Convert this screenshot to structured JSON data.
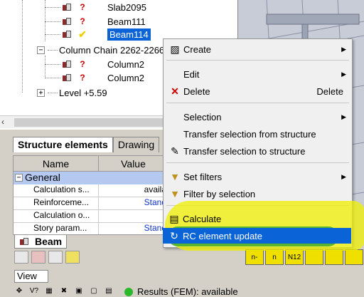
{
  "tree": {
    "rows": [
      {
        "label": "Slab2095",
        "mark": "?",
        "selected": false
      },
      {
        "label": "Beam111",
        "mark": "?",
        "selected": false
      },
      {
        "label": "Beam114",
        "mark": "✔",
        "selected": true
      }
    ],
    "column_chain": "Column Chain 2262-2266",
    "column_rows": [
      {
        "label": "Column2",
        "mark": "?"
      },
      {
        "label": "Column2",
        "mark": "?"
      }
    ],
    "level": "Level +5.59",
    "expand_minus": "−",
    "expand_plus": "+"
  },
  "tabs": {
    "structure": "Structure elements",
    "drawing": "Drawing"
  },
  "grid": {
    "col_name": "Name",
    "col_value": "Value",
    "group": "General",
    "rows": [
      {
        "name": "Calculation s...",
        "value": "availa",
        "blue": false
      },
      {
        "name": "Reinforceme...",
        "value": "Stand",
        "blue": true
      },
      {
        "name": "Calculation o...",
        "value": "",
        "blue": false
      },
      {
        "name": "Story param...",
        "value": "Stand",
        "blue": true
      }
    ]
  },
  "beam_tab": "Beam",
  "view_field": "View",
  "status": {
    "results": "Results (FEM): available",
    "icon2": "V?"
  },
  "context_menu": {
    "create": "Create",
    "edit": "Edit",
    "delete": "Delete",
    "delete_shortcut": "Delete",
    "selection": "Selection",
    "transfer_from": "Transfer selection from structure",
    "transfer_to": "Transfer selection to structure",
    "set_filters": "Set filters",
    "filter_by": "Filter by selection",
    "calculate": "Calculate",
    "rc_update": "RC element update"
  },
  "right_toolbar": {
    "n12": "N12"
  },
  "colors": {
    "selection": "#0a64d8",
    "highlighter_yellow": "#f0f000",
    "highlighter_green": "#28a028",
    "status_green": "#2cb82c"
  }
}
